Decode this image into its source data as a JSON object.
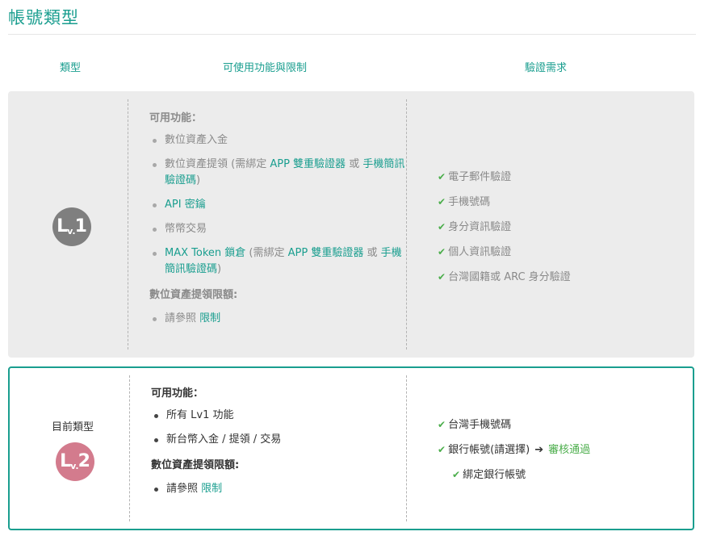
{
  "page": {
    "title": "帳號類型"
  },
  "columns": {
    "type": "類型",
    "features": "可使用功能與限制",
    "verification": "驗證需求"
  },
  "lv1": {
    "badge_big": "L",
    "badge_small": "v.",
    "badge_num": "1",
    "features_heading": "可用功能：",
    "features": [
      {
        "text": "數位資產入金"
      },
      {
        "pre": "數位資產提領 (需綁定 ",
        "link1": "APP 雙重驗證器",
        "mid": " 或 ",
        "link2": "手機簡訊驗證碼",
        "post": ")"
      },
      {
        "link": "API 密鑰"
      },
      {
        "text": "幣幣交易"
      },
      {
        "link0": "MAX Token 鎖倉",
        "pre": " (需綁定 ",
        "link1": "APP 雙重驗證器",
        "mid": " 或 ",
        "link2": "手機簡訊驗證碼",
        "post": ")"
      }
    ],
    "limit_heading": "數位資產提領限額:",
    "limit_pre": "請參照 ",
    "limit_link": "限制",
    "verifications": [
      "電子郵件驗證",
      "手機號碼",
      "身分資訊驗證",
      "個人資訊驗證",
      "台灣國籍或 ARC 身分驗證"
    ]
  },
  "lv2": {
    "current_label": "目前類型",
    "badge_big": "L",
    "badge_small": "v.",
    "badge_num": "2",
    "features_heading": "可用功能：",
    "features": [
      "所有 Lv1 功能",
      "新台幣入金 / 提領 / 交易"
    ],
    "limit_heading": "數位資產提領限額:",
    "limit_pre": "請參照 ",
    "limit_link": "限制",
    "verifications": {
      "phone": "台灣手機號碼",
      "bank": "銀行帳號(請選擇)",
      "bank_status": "審核通過",
      "bind": "綁定銀行帳號"
    }
  },
  "icons": {
    "check": "check-icon",
    "arrow": "arrow-right-icon"
  },
  "colors": {
    "accent": "#1a9e8f",
    "check": "#4cae4c",
    "lv1_badge": "#7f7f7f",
    "lv2_badge": "#d37b8d"
  }
}
